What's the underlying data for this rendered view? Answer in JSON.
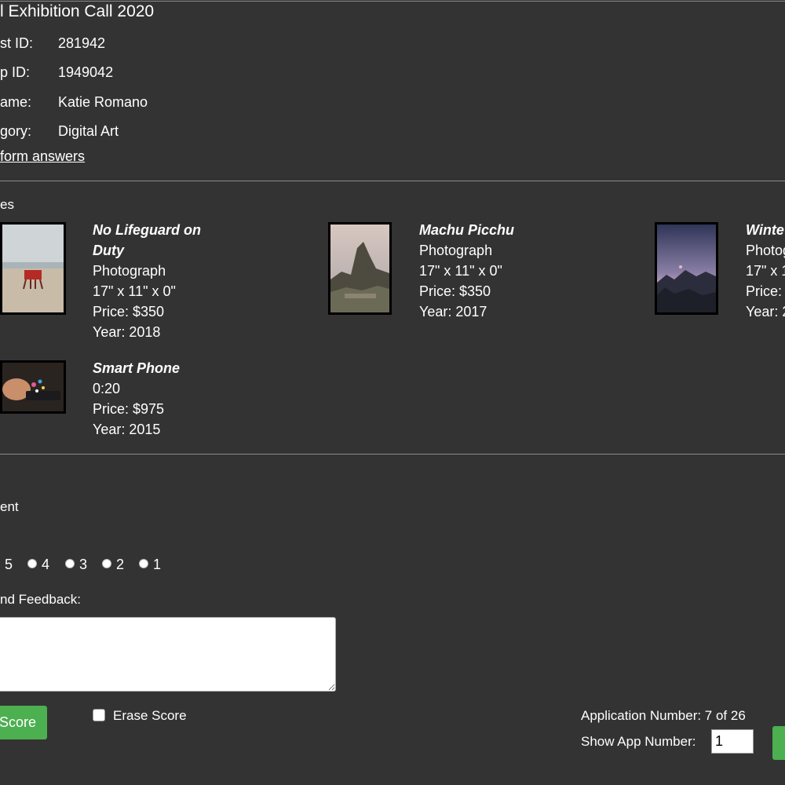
{
  "header": {
    "title": "l Exhibition Call 2020"
  },
  "info": {
    "rows": [
      {
        "label": "st ID:",
        "value": "281942"
      },
      {
        "label": "p ID:",
        "value": "1949042"
      },
      {
        "label": "ame:",
        "value": "Katie Romano"
      },
      {
        "label": "gory:",
        "value": "Digital Art"
      }
    ],
    "form_link": "form answers"
  },
  "artworks": {
    "section_label": "es",
    "items": [
      {
        "title_line1": "No Lifeguard on",
        "title_line2": "Duty",
        "medium": "Photograph",
        "dimensions": "17\" x 11\" x 0\"",
        "price": "Price: $350",
        "year": "Year: 2018"
      },
      {
        "title_line1": "Machu Picchu",
        "medium": "Photograph",
        "dimensions": "17\" x 11\" x 0\"",
        "price": "Price: $350",
        "year": "Year: 2017"
      },
      {
        "title_line1": "Winte",
        "medium": "Photog",
        "dimensions": "17\" x 1",
        "price": "Price: ",
        "year": "Year: 2"
      },
      {
        "title_line1": "Smart Phone",
        "medium": "0:20",
        "price": "Price: $975",
        "year": "Year: 2015"
      }
    ]
  },
  "scoring": {
    "section_label": "ent",
    "options": [
      "5",
      "4",
      "3",
      "2",
      "1"
    ],
    "feedback_label": "nd Feedback:",
    "feedback_value": "",
    "score_button": "Score",
    "erase_label": "Erase Score"
  },
  "navigation": {
    "app_number_text": "Application Number: 7 of 26",
    "show_app_label": "Show App Number:",
    "show_app_value": "1"
  },
  "colors": {
    "background": "#333333",
    "accent_green": "#4caf50"
  }
}
